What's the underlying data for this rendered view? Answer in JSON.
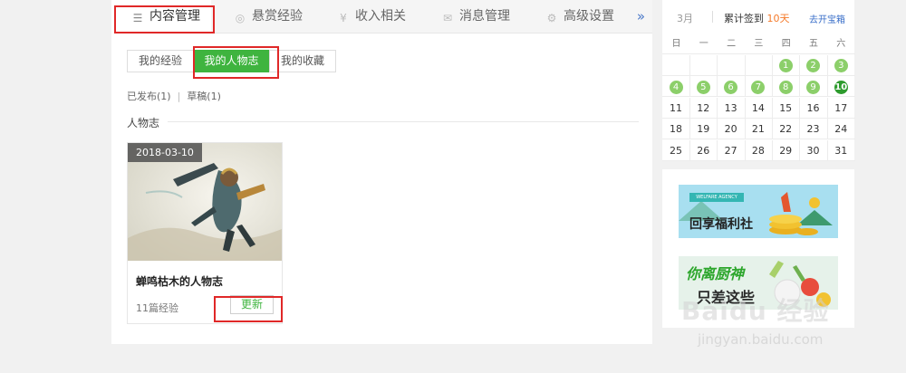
{
  "tabs": [
    {
      "label": "内容管理",
      "icon": "list-icon",
      "active": true
    },
    {
      "label": "悬赏经验",
      "icon": "coin-icon"
    },
    {
      "label": "收入相关",
      "icon": "yen-icon"
    },
    {
      "label": "消息管理",
      "icon": "mail-icon"
    },
    {
      "label": "高级设置",
      "icon": "gear-icon"
    }
  ],
  "tab_more": "»",
  "subtabs": [
    {
      "label": "我的经验"
    },
    {
      "label": "我的人物志",
      "active": true
    },
    {
      "label": "我的收藏"
    }
  ],
  "status": {
    "published": "已发布(1)",
    "separator": "|",
    "drafts": "草稿(1)"
  },
  "section_title": "人物志",
  "card": {
    "date": "2018-03-10",
    "title": "蝉鸣枯木的人物志",
    "count": "11篇经验",
    "update_label": "更新"
  },
  "calendar": {
    "month": "3月",
    "signin_prefix": "累计签到",
    "signin_days": "10天",
    "treasure_link": "去开宝箱",
    "weekdays": [
      "日",
      "一",
      "二",
      "三",
      "四",
      "五",
      "六"
    ],
    "weeks": [
      [
        "",
        "",
        "",
        "",
        "1",
        "2",
        "3"
      ],
      [
        "4",
        "5",
        "6",
        "7",
        "8",
        "9",
        "10"
      ],
      [
        "11",
        "12",
        "13",
        "14",
        "15",
        "16",
        "17"
      ],
      [
        "18",
        "19",
        "20",
        "21",
        "22",
        "23",
        "24"
      ],
      [
        "25",
        "26",
        "27",
        "28",
        "29",
        "30",
        "31"
      ]
    ],
    "signed_days": [
      "1",
      "2",
      "3",
      "4",
      "5",
      "6",
      "7",
      "8",
      "9",
      "10"
    ],
    "today": "10"
  },
  "ads": [
    {
      "ribbon": "WELFARE AGENCY",
      "text": "回享福利社"
    },
    {
      "text1": "你离厨神",
      "text2": "只差这些"
    }
  ],
  "watermark": {
    "main": "Baidu 经验",
    "sub": "jingyan.baidu.com"
  },
  "colors": {
    "accent_green": "#3fb43f",
    "highlight_red": "#e02828",
    "link_blue": "#3a6fc9",
    "signin_orange": "#f57a2a",
    "signed_dot": "#8ccf6a"
  }
}
